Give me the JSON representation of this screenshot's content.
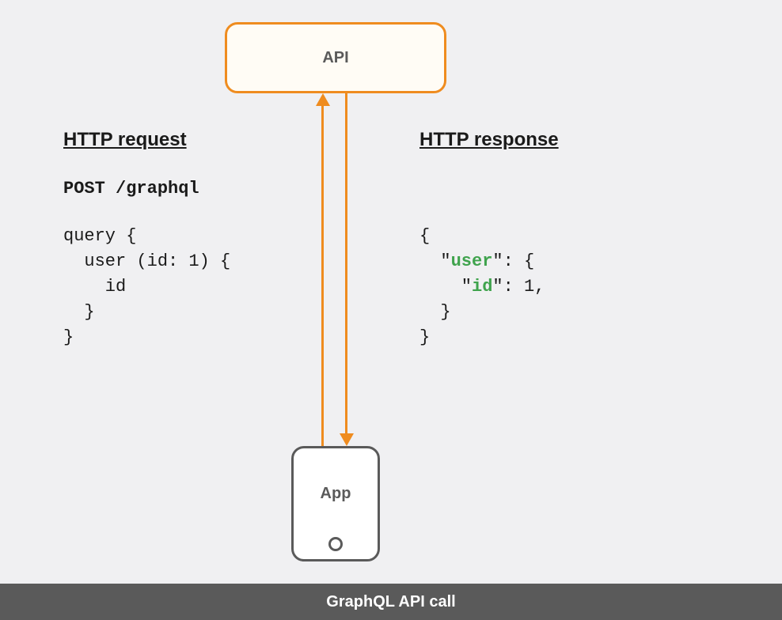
{
  "api_box_label": "API",
  "phone_label": "App",
  "request": {
    "heading": "HTTP request",
    "endpoint": "POST /graphql",
    "query_text": "query {\n  user (id: 1) {\n    id\n  }\n}"
  },
  "response": {
    "heading": "HTTP response",
    "body_prefix1": "{\n  \"",
    "key1": "user",
    "body_mid1": "\": {\n    \"",
    "key2": "id",
    "body_suffix": "\": 1,\n  }\n}"
  },
  "footer_caption": "GraphQL API call"
}
